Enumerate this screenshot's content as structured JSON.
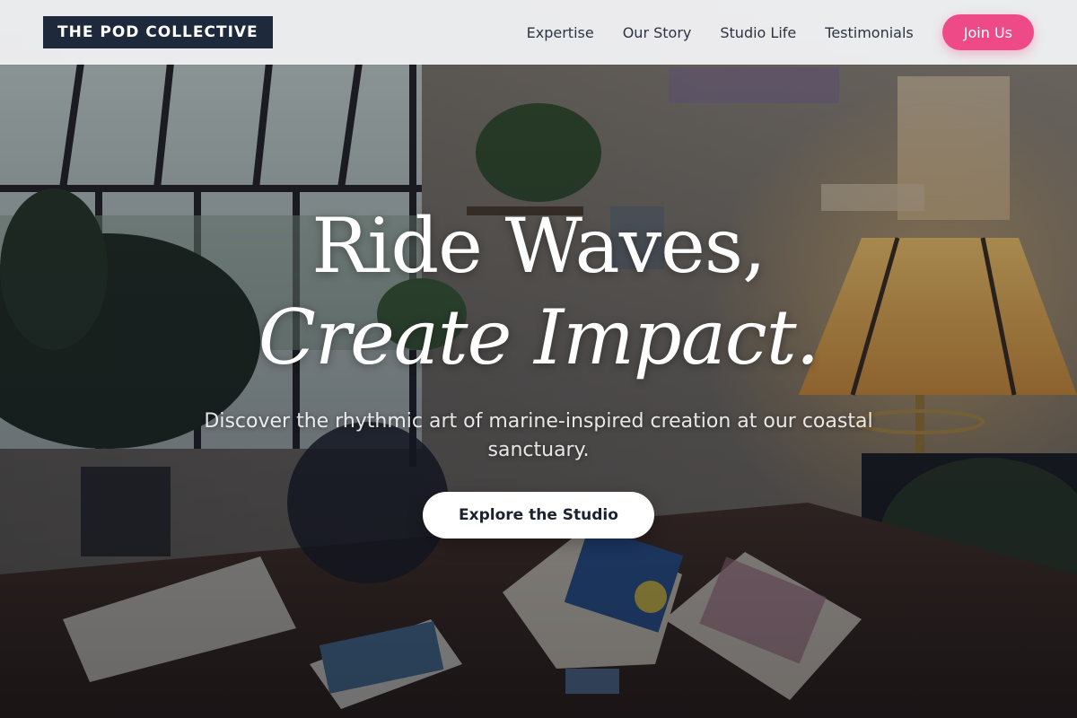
{
  "brand": {
    "name": "THE POD COLLECTIVE"
  },
  "nav": {
    "links": [
      "Expertise",
      "Our Story",
      "Studio Life",
      "Testimonials"
    ],
    "join_label": "Join Us"
  },
  "hero": {
    "headline_line1": "Ride Waves,",
    "headline_line2": "Create Impact.",
    "subtitle": "Discover the rhythmic art of marine-inspired creation at our coastal sanctuary.",
    "cta_label": "Explore the Studio"
  },
  "colors": {
    "brand_bg": "#1e2a3c",
    "accent_pink": "#ee4a87",
    "nav_bg": "#f3f4f6",
    "nav_text": "#2d3340",
    "cta_bg": "#ffffff"
  }
}
